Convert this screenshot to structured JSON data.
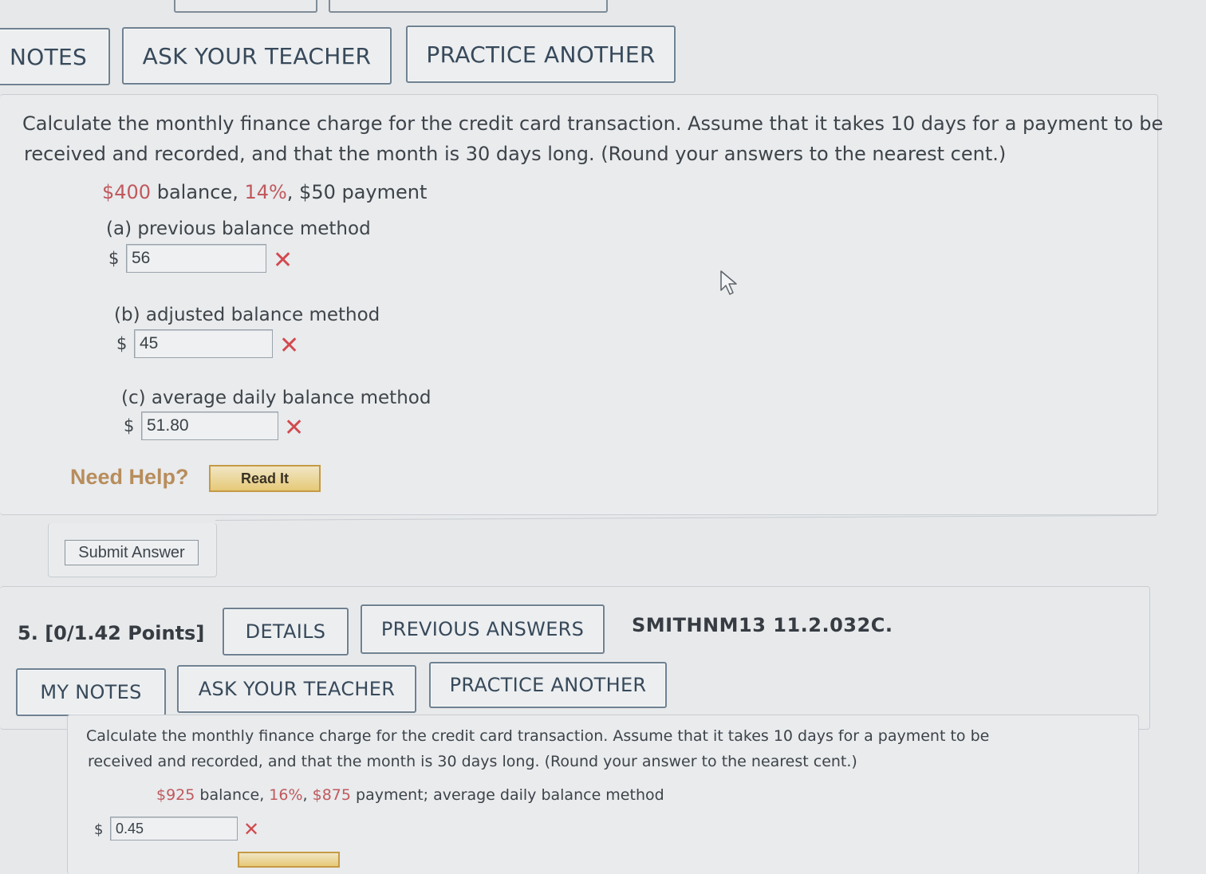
{
  "top_buttons": {
    "notes": "NOTES",
    "ask_teacher": "ASK YOUR TEACHER",
    "practice_another": "PRACTICE ANOTHER"
  },
  "question4": {
    "prompt_line1": "Calculate the monthly finance charge for the credit card transaction. Assume that it takes 10 days for a payment to be",
    "prompt_line2": "received and recorded, and that the month is 30 days long. (Round your answers to the nearest cent.)",
    "given": {
      "balance": "$400",
      "balance_text": " balance, ",
      "rate": "14%",
      "rate_text": ", $50 payment"
    },
    "parts": [
      {
        "label": "(a) previous balance method",
        "currency": "$",
        "value": "56",
        "status_icon": "incorrect-x-icon"
      },
      {
        "label": "(b) adjusted balance method",
        "currency": "$",
        "value": "45",
        "status_icon": "incorrect-x-icon"
      },
      {
        "label": "(c) average daily balance method",
        "currency": "$",
        "value": "51.80",
        "status_icon": "incorrect-x-icon"
      }
    ],
    "need_help": "Need Help?",
    "read_it": "Read It",
    "submit": "Submit Answer"
  },
  "question5": {
    "number": "5.",
    "points": "[0/1.42 Points]",
    "details": "DETAILS",
    "previous_answers": "PREVIOUS ANSWERS",
    "reference": "SMITHNM13 11.2.032C.",
    "my_notes": "MY NOTES",
    "ask_teacher": "ASK YOUR TEACHER",
    "practice_another": "PRACTICE ANOTHER",
    "prompt_line1": "Calculate the monthly finance charge for the credit card transaction. Assume that it takes 10 days for a payment to be",
    "prompt_line2": "received and recorded, and that the month is 30 days long. (Round your answer to the nearest cent.)",
    "given": {
      "balance": "$925",
      "balance_text": " balance, ",
      "rate": "16%",
      "rate_text": ", ",
      "payment": "$875",
      "payment_text": " payment; average daily balance method"
    },
    "answer": {
      "currency": "$",
      "value": "0.45",
      "status_icon": "incorrect-x-icon"
    }
  },
  "colors": {
    "accent_red": "#c0595d",
    "incorrect_x": "#d14a4f",
    "need_help": "#b88d5c",
    "button_border": "#6f8191"
  }
}
